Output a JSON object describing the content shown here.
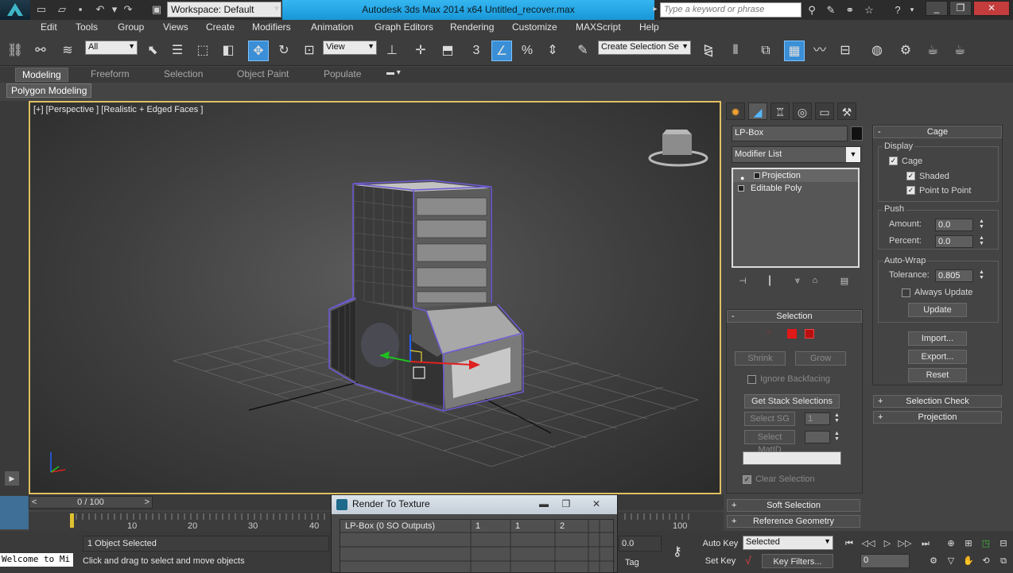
{
  "window": {
    "title": "Autodesk 3ds Max  2014 x64     Untitled_recover.max",
    "workspace": "Workspace: Default",
    "search_placeholder": "Type a keyword or phrase"
  },
  "menu": [
    "Edit",
    "Tools",
    "Group",
    "Views",
    "Create",
    "Modifiers",
    "Animation",
    "Graph Editors",
    "Rendering",
    "Customize",
    "MAXScript",
    "Help"
  ],
  "toolbar": {
    "filter": "All",
    "ref_coord": "View",
    "named_selection": "Create Selection Se",
    "snap_label": "3"
  },
  "ribbon": {
    "tabs": [
      "Modeling",
      "Freeform",
      "Selection",
      "Object Paint",
      "Populate"
    ],
    "active_panel": "Polygon Modeling"
  },
  "viewport": {
    "label": "[+] [Perspective ] [Realistic + Edged Faces ]"
  },
  "command_panel": {
    "object_name": "LP-Box",
    "object_color": "#000000",
    "modifier_list": "Modifier List",
    "stack": [
      "Projection",
      "Editable Poly"
    ],
    "selection": {
      "title": "Selection",
      "shrink": "Shrink",
      "grow": "Grow",
      "ignore_backfacing": "Ignore Backfacing",
      "get_stack": "Get Stack Selections",
      "select_sg": "Select SG",
      "sg_value": "1",
      "select_matid": "Select MatID",
      "clear_selection": "Clear Selection"
    },
    "soft_selection": "Soft Selection",
    "reference_geometry": "Reference Geometry",
    "cage": {
      "title": "Cage",
      "display": "Display",
      "cage_label": "Cage",
      "shaded": "Shaded",
      "point_to_point": "Point to Point",
      "push": "Push",
      "amount_label": "Amount:",
      "amount": "0.0",
      "percent_label": "Percent:",
      "percent": "0.0",
      "auto_wrap": "Auto-Wrap",
      "tolerance_label": "Tolerance:",
      "tolerance": "0.805",
      "always_update": "Always Update",
      "update": "Update",
      "import": "Import...",
      "export": "Export...",
      "reset": "Reset"
    },
    "selection_check": "Selection Check",
    "projection": "Projection"
  },
  "timeline": {
    "frame": "0 / 100",
    "ticks": [
      "10",
      "20",
      "30",
      "40",
      "100"
    ]
  },
  "status": {
    "maxscript": "Welcome to Mi",
    "selected": "1 Object Selected",
    "prompt": "Click and drag to select and move objects",
    "coord_value": "0.0",
    "add_tag": "Tag"
  },
  "render_to_texture": {
    "title": "Render To Texture",
    "row_label": "LP-Box (0 SO Outputs)",
    "cols": [
      "1",
      "1",
      "2"
    ]
  },
  "anim_controls": {
    "auto_key": "Auto Key",
    "set_key": "Set Key",
    "selected": "Selected",
    "key_filters": "Key Filters...",
    "frame": "0"
  },
  "colors": {
    "title_accent": "#1f9fe0",
    "active_tool": "#3a8fd6",
    "cage_wire": "#6b5bd6",
    "gizmo_x": "#e02020",
    "gizmo_y": "#20c020",
    "gizmo_z": "#2060ff"
  }
}
